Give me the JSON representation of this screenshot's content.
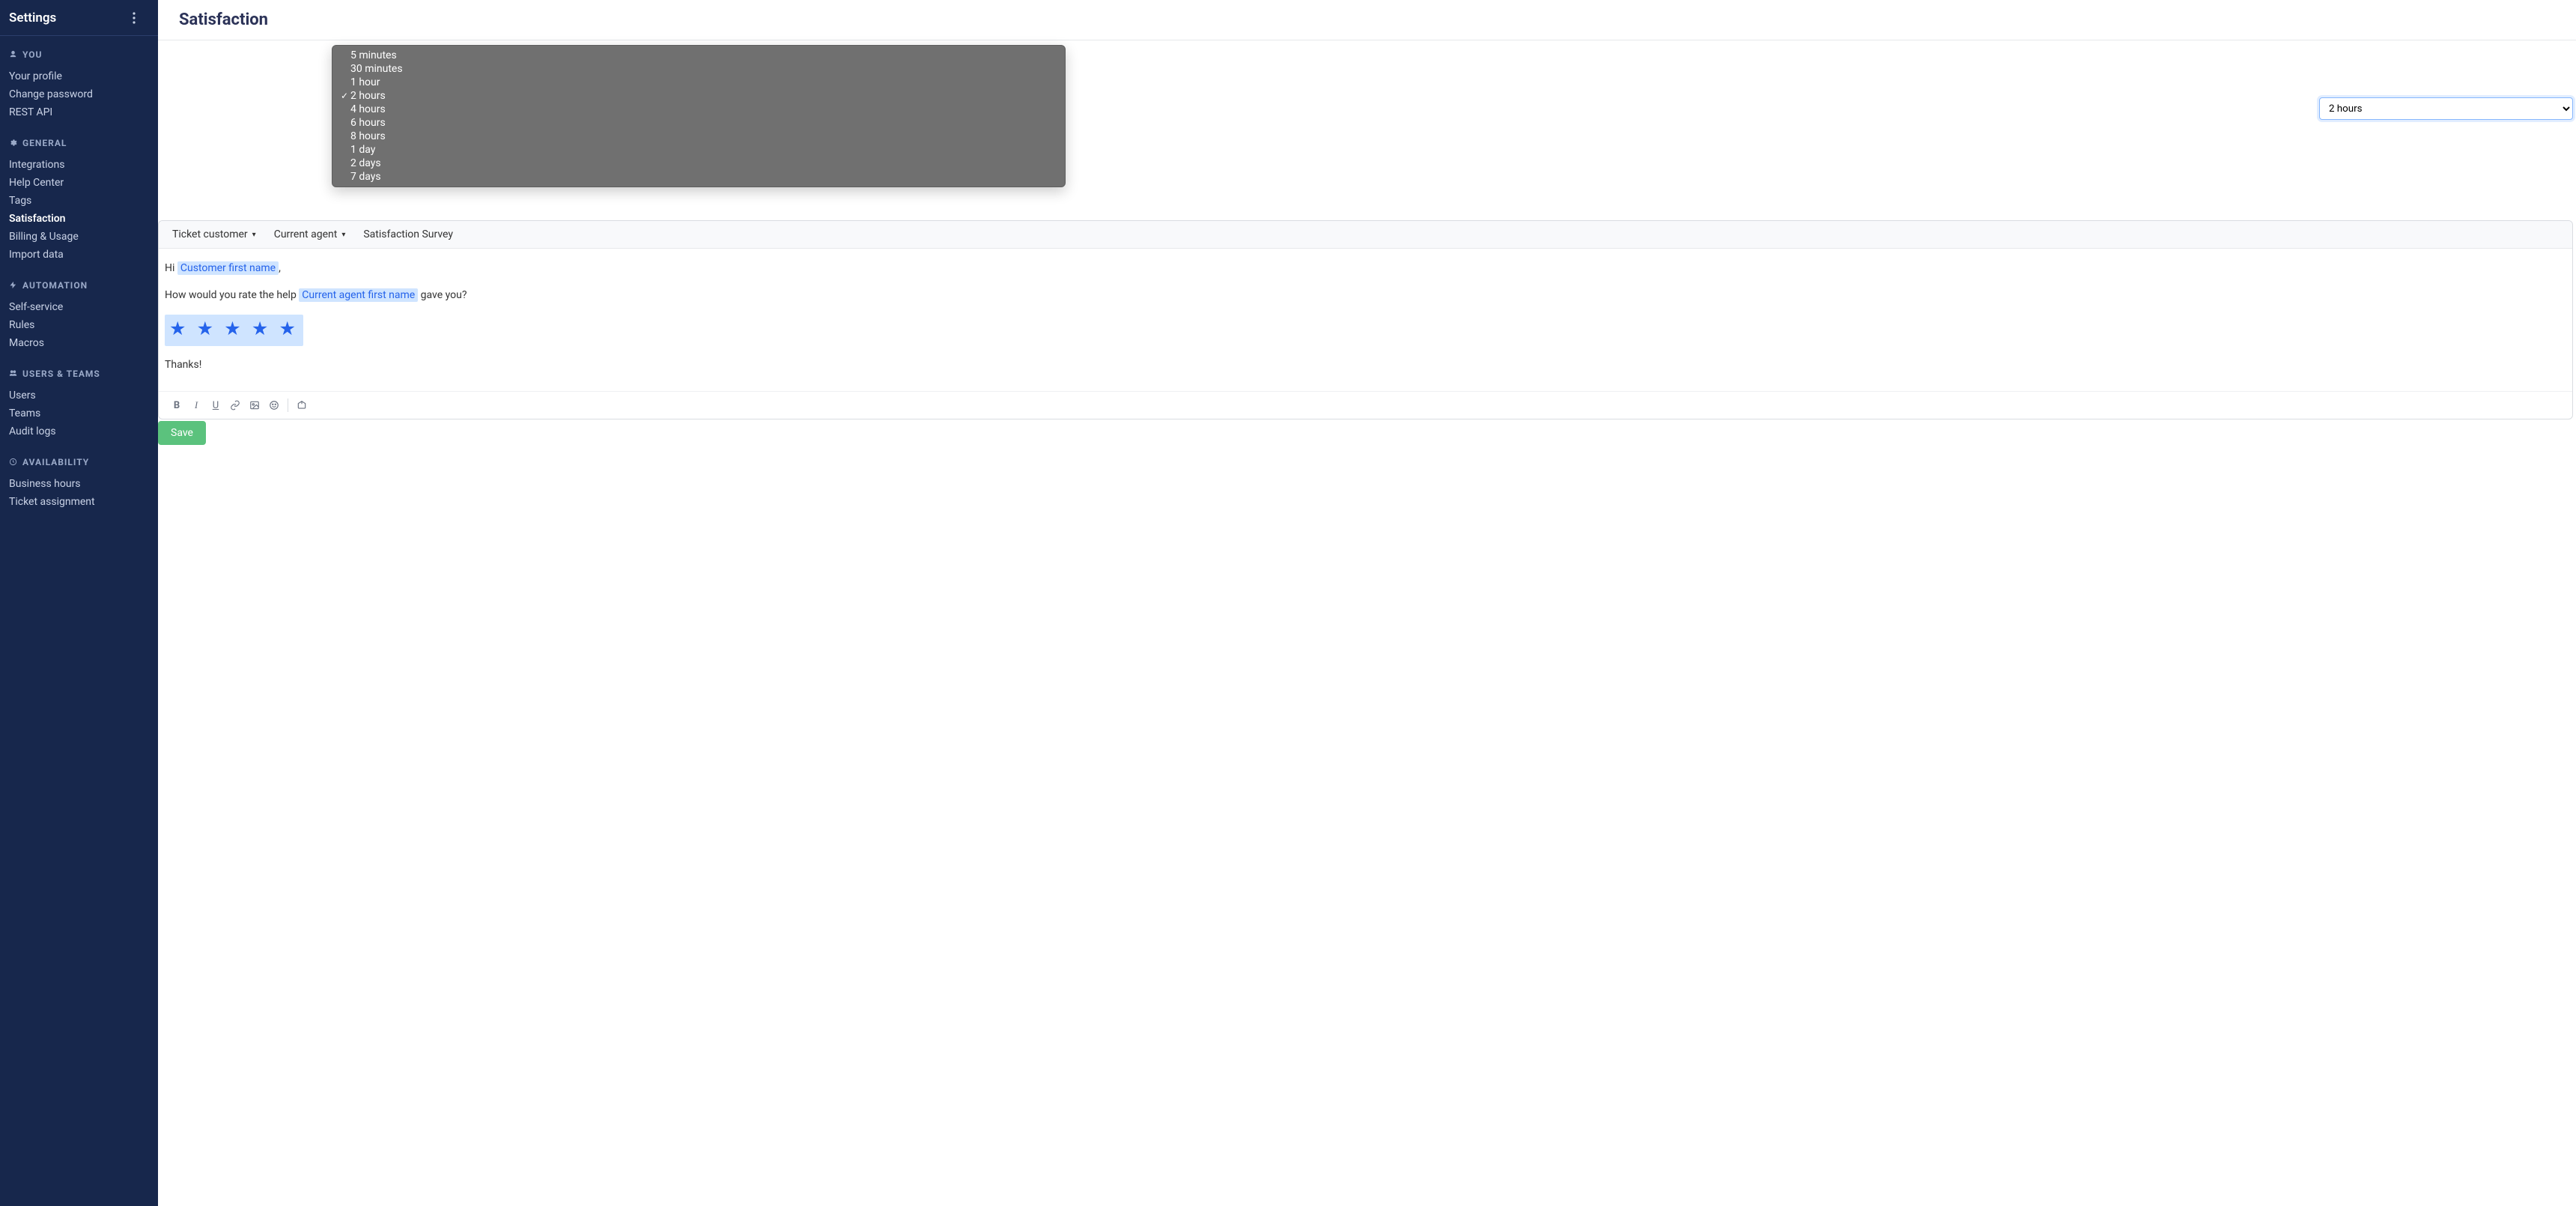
{
  "sidebar": {
    "title": "Settings",
    "groups": [
      {
        "icon": "user-icon",
        "label": "YOU",
        "items": [
          {
            "label": "Your profile",
            "active": false
          },
          {
            "label": "Change password",
            "active": false
          },
          {
            "label": "REST API",
            "active": false
          }
        ]
      },
      {
        "icon": "gear-icon",
        "label": "GENERAL",
        "items": [
          {
            "label": "Integrations",
            "active": false
          },
          {
            "label": "Help Center",
            "active": false
          },
          {
            "label": "Tags",
            "active": false
          },
          {
            "label": "Satisfaction",
            "active": true
          },
          {
            "label": "Billing & Usage",
            "active": false
          },
          {
            "label": "Import data",
            "active": false
          }
        ]
      },
      {
        "icon": "bolt-icon",
        "label": "AUTOMATION",
        "items": [
          {
            "label": "Self-service",
            "active": false
          },
          {
            "label": "Rules",
            "active": false
          },
          {
            "label": "Macros",
            "active": false
          }
        ]
      },
      {
        "icon": "users-icon",
        "label": "USERS & TEAMS",
        "items": [
          {
            "label": "Users",
            "active": false
          },
          {
            "label": "Teams",
            "active": false
          },
          {
            "label": "Audit logs",
            "active": false
          }
        ]
      },
      {
        "icon": "clock-icon",
        "label": "AVAILABILITY",
        "items": [
          {
            "label": "Business hours",
            "active": false
          },
          {
            "label": "Ticket assignment",
            "active": false
          }
        ]
      }
    ]
  },
  "page": {
    "title": "Satisfaction"
  },
  "dropdown": {
    "selected_index": 3,
    "checkmark": "✓",
    "options": [
      "5 minutes",
      "30 minutes",
      "1 hour",
      "2 hours",
      "4 hours",
      "6 hours",
      "8 hours",
      "1 day",
      "2 days",
      "7 days"
    ]
  },
  "timing_select_value": "2 hours",
  "editor": {
    "var_buttons": [
      {
        "label": "Ticket customer",
        "hasCaret": true
      },
      {
        "label": "Current agent",
        "hasCaret": true
      },
      {
        "label": "Satisfaction Survey",
        "hasCaret": false
      }
    ],
    "body": {
      "greeting_prefix": "Hi ",
      "customer_placeholder": "Customer first name",
      "greeting_suffix": ",",
      "question_prefix": "How would you rate the help ",
      "agent_placeholder": "Current agent first name",
      "question_suffix": " gave you?",
      "thanks": "Thanks!"
    },
    "stars": "★ ★ ★ ★ ★",
    "format_bar": {
      "bold": "B",
      "italic": "I",
      "underline": "U"
    }
  },
  "buttons": {
    "save": "Save"
  },
  "colors": {
    "sidebar_bg": "#17274c",
    "accent": "#2563eb",
    "save": "#5bc27d",
    "dropdown_bg": "#707070"
  }
}
